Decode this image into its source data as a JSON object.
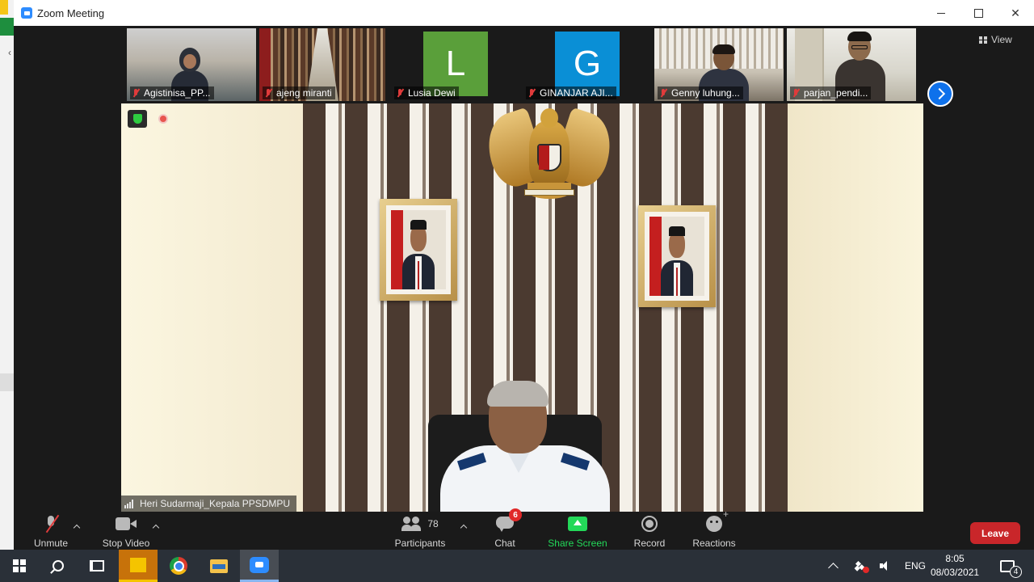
{
  "window": {
    "title": "Zoom Meeting"
  },
  "participants_strip": [
    {
      "name": "Agistinisa_PP...",
      "muted": true,
      "type": "video"
    },
    {
      "name": "ajeng miranti",
      "muted": true,
      "type": "video"
    },
    {
      "name": "Lusia Dewi",
      "muted": true,
      "type": "avatar",
      "initial": "L",
      "color": "#5a9f3a"
    },
    {
      "name": "GINANJAR AJI...",
      "muted": true,
      "type": "avatar",
      "initial": "G",
      "color": "#0a8fd6"
    },
    {
      "name": "Genny luhung...",
      "muted": true,
      "type": "video"
    },
    {
      "name": "parjan_pendi...",
      "muted": true,
      "type": "video"
    }
  ],
  "view_button": {
    "label": "View",
    "icon": "grid-icon"
  },
  "active_speaker": {
    "name": "Heri Sudarmaji_Kepala PPSDMPU"
  },
  "toolbar": {
    "unmute_label": "Unmute",
    "stop_video_label": "Stop Video",
    "participants_label": "Participants",
    "participants_count": "78",
    "chat_label": "Chat",
    "chat_badge": "6",
    "share_label": "Share Screen",
    "record_label": "Record",
    "reactions_label": "Reactions",
    "leave_label": "Leave"
  },
  "taskbar": {
    "language": "ENG",
    "time": "8:05",
    "date": "08/03/2021",
    "notifications_count": "4"
  },
  "colors": {
    "zoom_blue": "#2d8cff",
    "share_green": "#23d959",
    "leave_red": "#c9262a",
    "badge_red": "#e02828"
  }
}
